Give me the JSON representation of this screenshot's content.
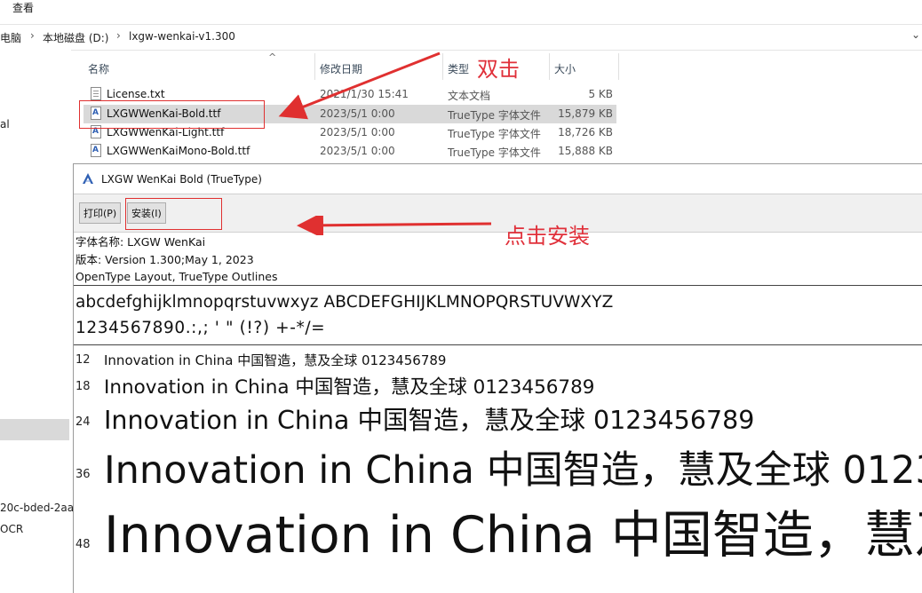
{
  "explorer": {
    "menu_view": "查看",
    "breadcrumb": [
      "电脑",
      "本地磁盘 (D:)",
      "lxgw-wenkai-v1.300"
    ],
    "nav_items": [
      "al",
      "20c-bded-2aa",
      "OCR"
    ],
    "columns": {
      "name": "名称",
      "date": "修改日期",
      "type": "类型",
      "size": "大小"
    },
    "files": [
      {
        "name": "License.txt",
        "date": "2021/1/30 15:41",
        "type": "文本文档",
        "size": "5 KB",
        "icon": "text-file-icon"
      },
      {
        "name": "LXGWWenKai-Bold.ttf",
        "date": "2023/5/1 0:00",
        "type": "TrueType 字体文件",
        "size": "15,879 KB",
        "icon": "font-file-icon",
        "selected": true
      },
      {
        "name": "LXGWWenKai-Light.ttf",
        "date": "2023/5/1 0:00",
        "type": "TrueType 字体文件",
        "size": "18,726 KB",
        "icon": "font-file-icon"
      },
      {
        "name": "LXGWWenKaiMono-Bold.ttf",
        "date": "2023/5/1 0:00",
        "type": "TrueType 字体文件",
        "size": "15,888 KB",
        "icon": "font-file-icon"
      }
    ]
  },
  "annotations": {
    "double_click": "双击",
    "click_install": "点击安装",
    "color": "#e03030"
  },
  "viewer": {
    "title": "LXGW WenKai Bold (TrueType)",
    "print_button": "打印(P)",
    "install_button": "安装(I)",
    "info": [
      "字体名称: LXGW WenKai",
      "版本: Version 1.300;May 1, 2023",
      "OpenType Layout, TrueType Outlines"
    ],
    "sample_alpha": "abcdefghijklmnopqrstuvwxyz ABCDEFGHIJKLMNOPQRSTUVWXYZ",
    "sample_numeric": "1234567890.:,; ' \" (!?) +-*/=",
    "sample_sentence": "Innovation in China 中国智造，慧及全球 0123456789",
    "sizes": [
      "12",
      "18",
      "24",
      "36",
      "48"
    ]
  }
}
